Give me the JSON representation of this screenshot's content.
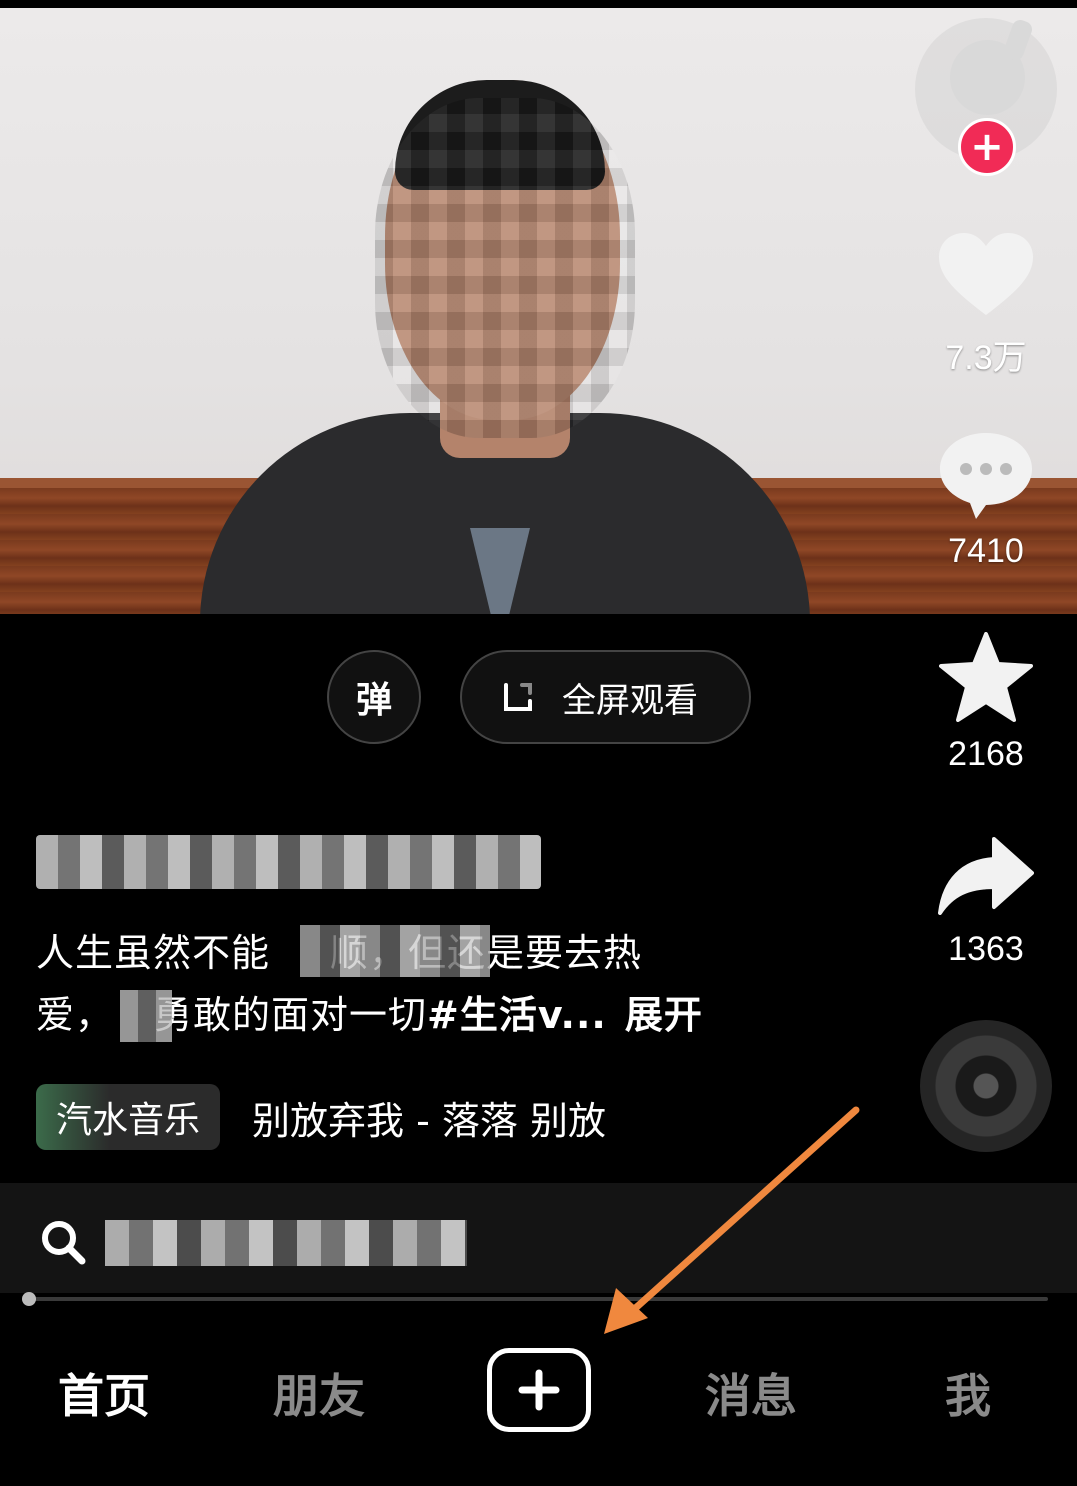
{
  "video": {
    "danmu_label": "弹",
    "fullscreen_label": "全屏观看"
  },
  "rail": {
    "likes": "7.3万",
    "comments": "7410",
    "favorites": "2168",
    "shares": "1363",
    "follow_symbol": "+"
  },
  "caption": {
    "line1_a": "人生虽然不能",
    "line1_b": "顺，但还是要去热",
    "line2_a": "爱，",
    "line2_b": "勇敢的面对一切",
    "hashtag": "#生活v...",
    "expand": "展开"
  },
  "music": {
    "tag": "汽水音乐",
    "title": "别放弃我 - 落落   别放"
  },
  "playback": {
    "progress_fraction": 0.01
  },
  "nav": {
    "home": "首页",
    "friends": "朋友",
    "messages": "消息",
    "me": "我"
  },
  "colors": {
    "follow_red": "#f12b56",
    "annotation_arrow": "#f0883e"
  }
}
